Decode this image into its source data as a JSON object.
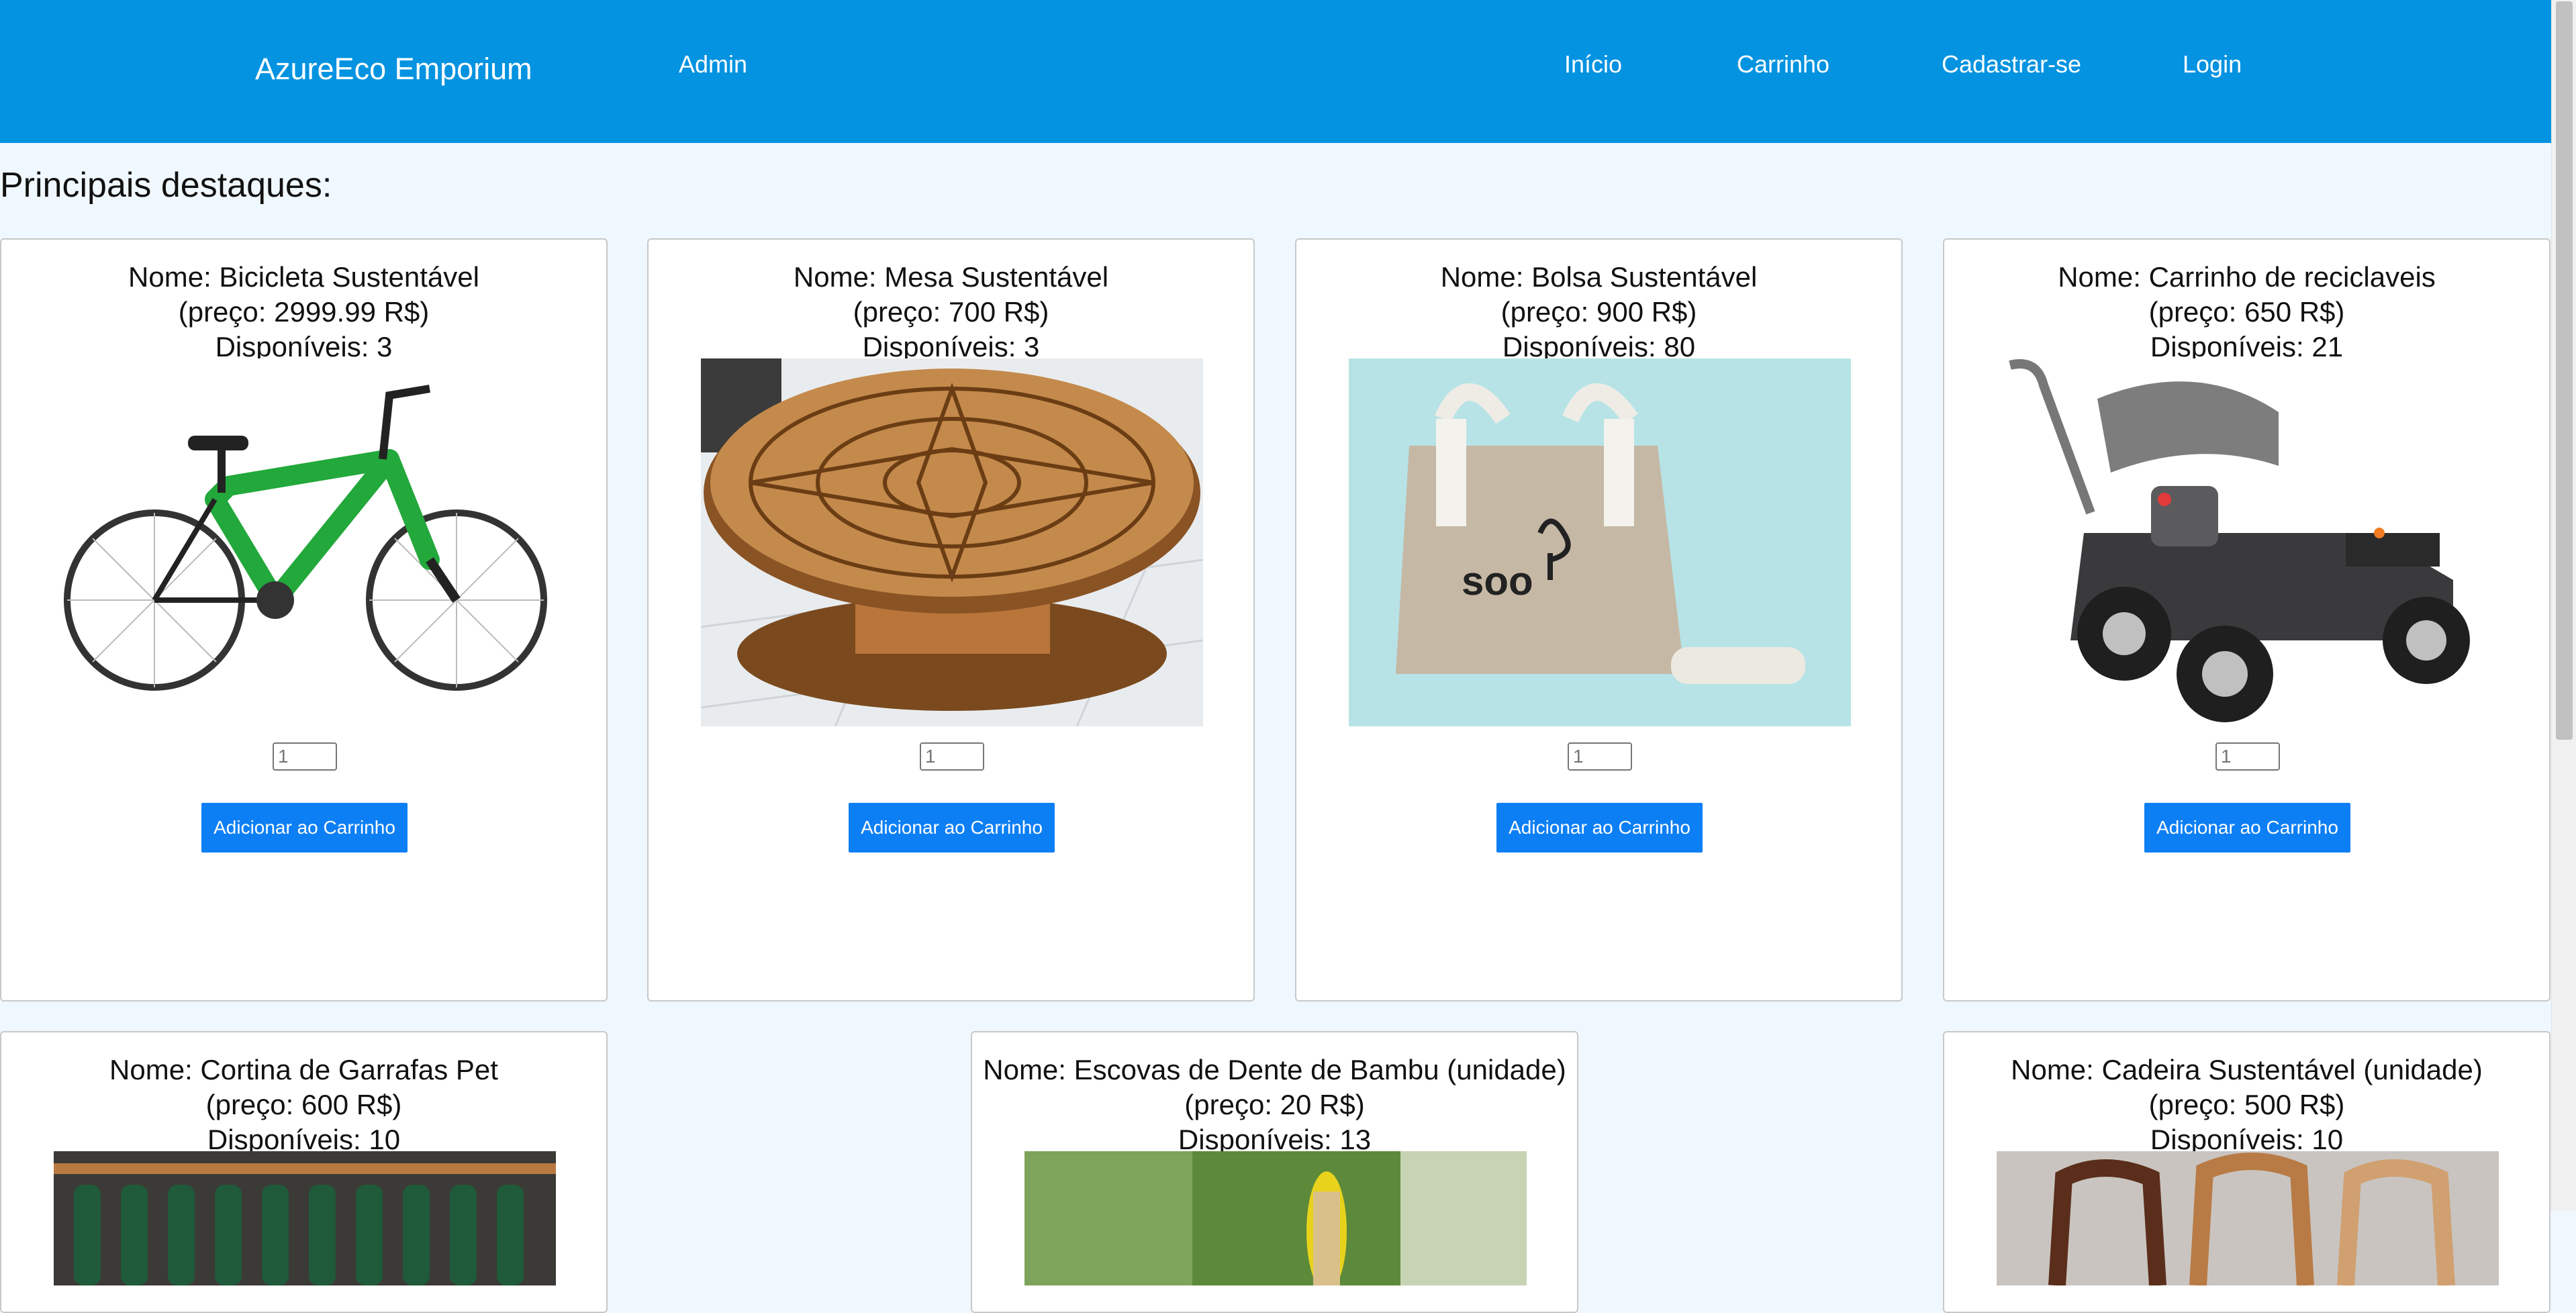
{
  "navbar": {
    "brand": "AzureEco Emporium",
    "admin": "Admin",
    "links": [
      "Início",
      "Carrinho",
      "Cadastrar-se",
      "Login"
    ]
  },
  "section_title": "Principais destaques:",
  "products": [
    {
      "name": "Nome: Bicicleta Sustentável",
      "price": "(preço: 2999.99 R$)",
      "stock": "Disponíveis: 3",
      "qty_placeholder": "1",
      "button": "Adicionar ao Carrinho"
    },
    {
      "name": "Nome: Mesa Sustentável",
      "price": "(preço: 700 R$)",
      "stock": "Disponíveis: 3",
      "qty_placeholder": "1",
      "button": "Adicionar ao Carrinho"
    },
    {
      "name": "Nome: Bolsa Sustentável",
      "price": "(preço: 900 R$)",
      "stock": "Disponíveis: 80",
      "qty_placeholder": "1",
      "button": "Adicionar ao Carrinho"
    },
    {
      "name": "Nome: Carrinho de reciclaveis",
      "price": "(preço: 650 R$)",
      "stock": "Disponíveis: 21",
      "qty_placeholder": "1",
      "button": "Adicionar ao Carrinho"
    },
    {
      "name": "Nome: Cortina de Garrafas Pet",
      "price": "(preço: 600 R$)",
      "stock": "Disponíveis: 10"
    },
    {
      "name": "Nome: Escovas de Dente de Bambu (unidade)",
      "price": "(preço: 20 R$)",
      "stock": "Disponíveis: 13"
    },
    {
      "name": "Nome: Cadeira Sustentável (unidade)",
      "price": "(preço: 500 R$)",
      "stock": "Disponíveis: 10"
    }
  ],
  "colors": {
    "navbar": "#0393e1",
    "page_background": "#f0f8ff",
    "button": "#0d7ff5"
  }
}
